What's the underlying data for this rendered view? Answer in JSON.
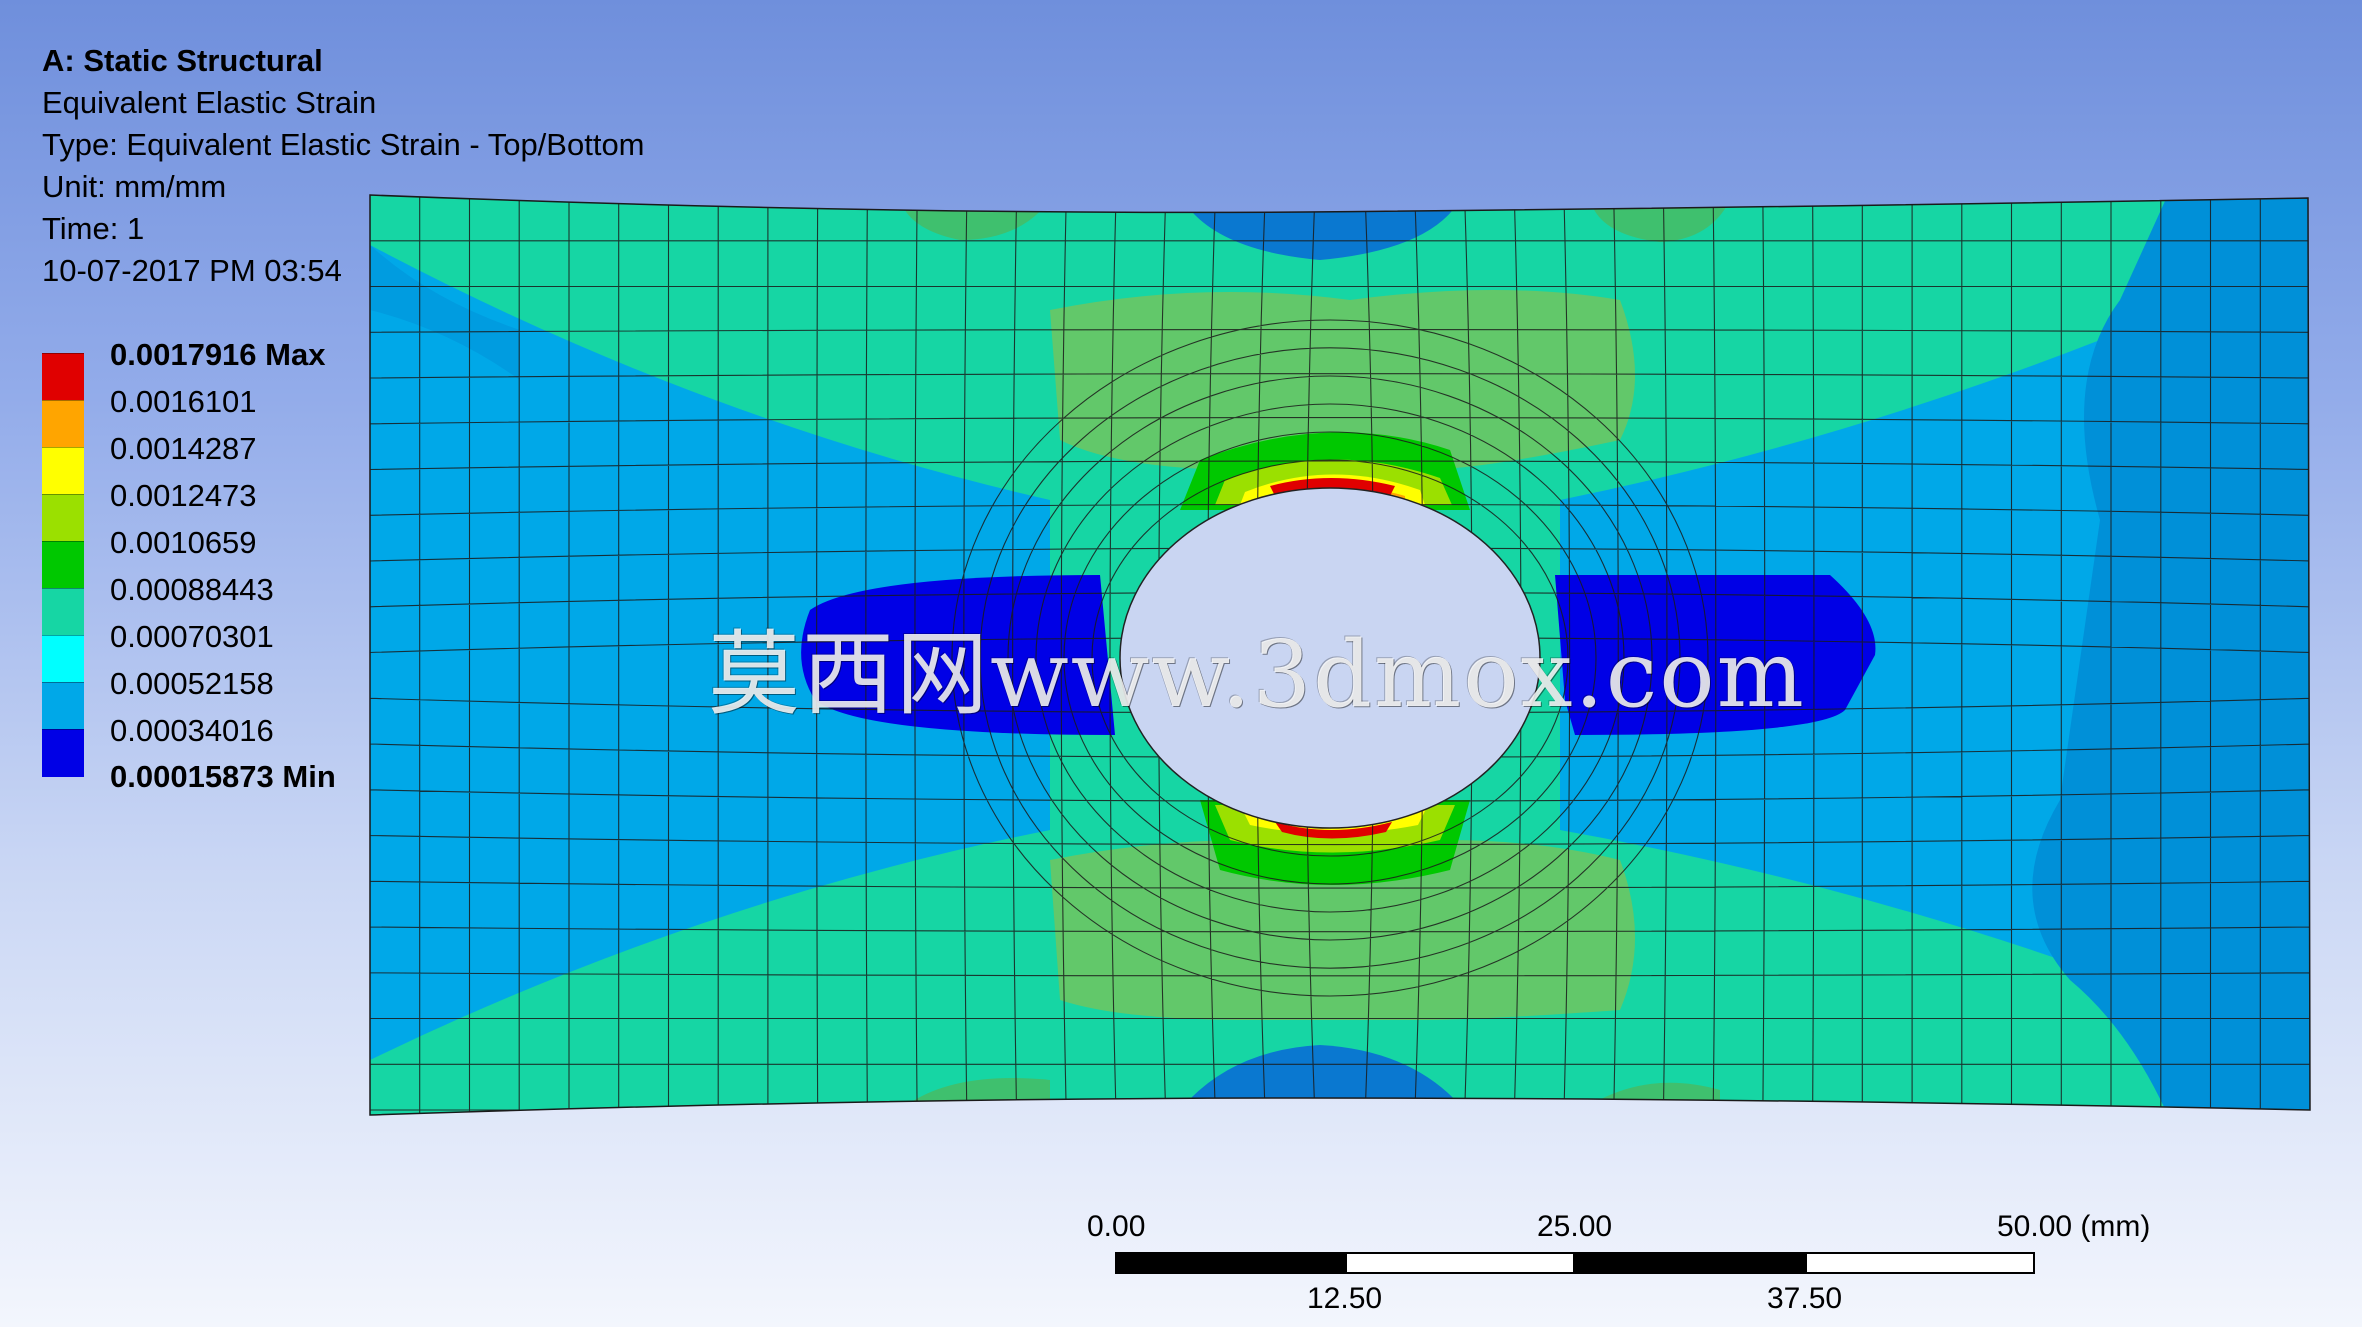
{
  "header": {
    "system": "A: Static Structural",
    "result": "Equivalent Elastic Strain",
    "type": "Type: Equivalent Elastic Strain - Top/Bottom",
    "unit": "Unit: mm/mm",
    "time": "Time: 1",
    "timestamp": "10-07-2017 PM 03:54"
  },
  "legend": {
    "max_label": "0.0017916 Max",
    "levels": [
      "0.0016101",
      "0.0014287",
      "0.0012473",
      "0.0010659",
      "0.00088443",
      "0.00070301",
      "0.00052158",
      "0.00034016"
    ],
    "min_label": "0.00015873 Min",
    "colors": [
      "#e00000",
      "#ffa500",
      "#ffff00",
      "#9be000",
      "#00c800",
      "#16d6a4",
      "#00ffff",
      "#00a8e8",
      "#0000e6"
    ]
  },
  "watermark": "莫西网www.3dmox.com",
  "scale_bar": {
    "top_ticks": [
      "0.00",
      "25.00",
      "50.00 (mm)"
    ],
    "bottom_ticks": [
      "12.50",
      "37.50"
    ]
  }
}
